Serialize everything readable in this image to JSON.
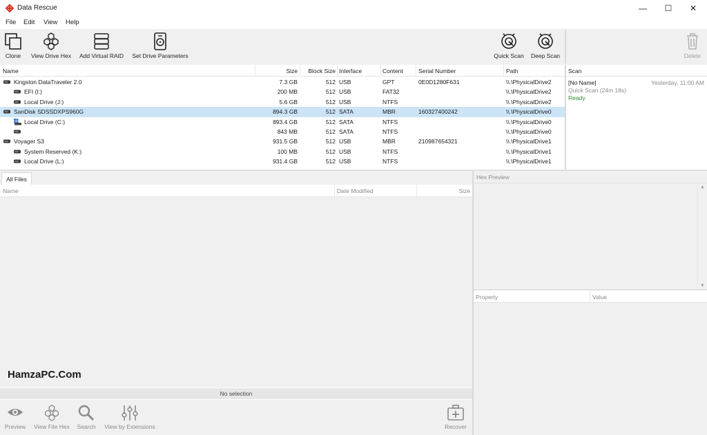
{
  "window": {
    "title": "Data Rescue",
    "minimize": "—",
    "maximize": "☐",
    "close": "✕"
  },
  "menu": [
    "File",
    "Edit",
    "View",
    "Help"
  ],
  "toolbar": {
    "clone": "Clone",
    "view_drive_hex": "View Drive Hex",
    "add_virtual_raid": "Add Virtual RAID",
    "set_drive_parameters": "Set Drive Parameters",
    "quick_scan": "Quick Scan",
    "deep_scan": "Deep Scan",
    "delete": "Delete"
  },
  "drives": {
    "columns": {
      "name": "Name",
      "size": "Size",
      "block_size": "Block Size",
      "interface": "Interface",
      "content": "Content",
      "serial": "Serial Number",
      "path": "Path"
    },
    "rows": [
      {
        "name": "Kingston DataTraveler 2.0",
        "size": "7.3 GB",
        "block": "512",
        "iface": "USB",
        "content": "GPT",
        "serial": "0E0D1280F631",
        "path": "\\\\.\\PhysicalDrive2",
        "level": 0,
        "selected": false,
        "icon": "drive-icon"
      },
      {
        "name": "EFI (I:)",
        "size": "200 MB",
        "block": "512",
        "iface": "USB",
        "content": "FAT32",
        "serial": "",
        "path": "\\\\.\\PhysicalDrive2",
        "level": 1,
        "selected": false,
        "icon": "volume-icon"
      },
      {
        "name": "Local Drive (J:)",
        "size": "5.6 GB",
        "block": "512",
        "iface": "USB",
        "content": "NTFS",
        "serial": "",
        "path": "\\\\.\\PhysicalDrive2",
        "level": 1,
        "selected": false,
        "icon": "volume-icon"
      },
      {
        "name": "SanDisk SDSSDXPS960G",
        "size": "894.3 GB",
        "block": "512",
        "iface": "SATA",
        "content": "MBR",
        "serial": "160327400242",
        "path": "\\\\.\\PhysicalDrive0",
        "level": 0,
        "selected": true,
        "icon": "drive-icon"
      },
      {
        "name": "Local Drive (C:)",
        "size": "893.4 GB",
        "block": "512",
        "iface": "SATA",
        "content": "NTFS",
        "serial": "",
        "path": "\\\\.\\PhysicalDrive0",
        "level": 1,
        "selected": false,
        "icon": "windows-volume-icon"
      },
      {
        "name": "",
        "size": "843 MB",
        "block": "512",
        "iface": "SATA",
        "content": "NTFS",
        "serial": "",
        "path": "\\\\.\\PhysicalDrive0",
        "level": 1,
        "selected": false,
        "icon": "volume-icon"
      },
      {
        "name": "Voyager S3",
        "size": "931.5 GB",
        "block": "512",
        "iface": "USB",
        "content": "MBR",
        "serial": "210987654321",
        "path": "\\\\.\\PhysicalDrive1",
        "level": 0,
        "selected": false,
        "icon": "drive-icon"
      },
      {
        "name": "System Reserved (K:)",
        "size": "100 MB",
        "block": "512",
        "iface": "USB",
        "content": "NTFS",
        "serial": "",
        "path": "\\\\.\\PhysicalDrive1",
        "level": 1,
        "selected": false,
        "icon": "volume-icon"
      },
      {
        "name": "Local Drive (L:)",
        "size": "931.4 GB",
        "block": "512",
        "iface": "USB",
        "content": "NTFS",
        "serial": "",
        "path": "\\\\.\\PhysicalDrive1",
        "level": 1,
        "selected": false,
        "icon": "volume-icon"
      }
    ]
  },
  "scan_panel": {
    "header": "Scan",
    "entry_name": "[No Name]",
    "entry_time": "Yesterday, 11:00 AM",
    "entry_type": "Quick Scan (24m 18s)",
    "entry_status": "Ready",
    "status_color": "#2e8b2e"
  },
  "files": {
    "tab": "All Files",
    "col_name": "Name",
    "col_date": "Date Modified",
    "col_size": "Size",
    "no_selection": "No selection"
  },
  "watermark": "HamzaPC.Com",
  "bottom_toolbar": {
    "preview": "Preview",
    "view_file_hex": "View File Hex",
    "search": "Search",
    "view_by_extensions": "View by Extensions",
    "recover": "Recover"
  },
  "hex_preview": {
    "header": "Hex Preview"
  },
  "properties": {
    "col_property": "Property",
    "col_value": "Value"
  },
  "colors": {
    "accent_red": "#d9342b",
    "selection": "#cce4f7"
  }
}
